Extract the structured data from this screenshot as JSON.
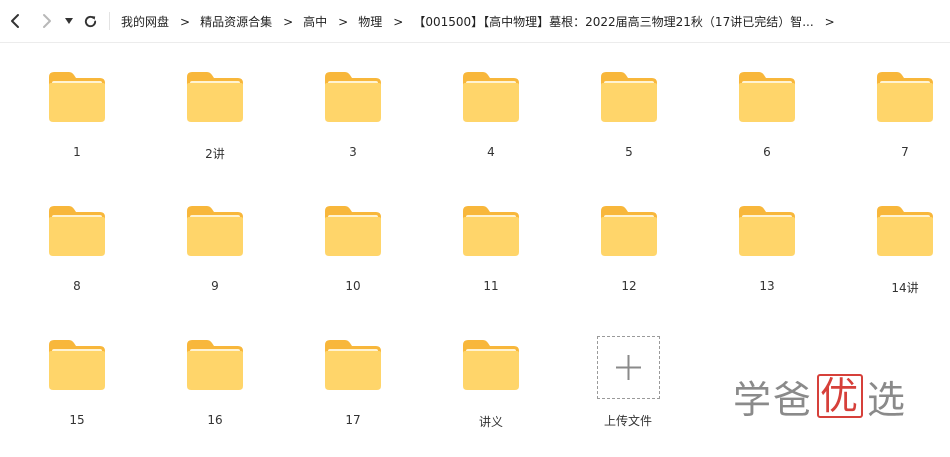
{
  "nav": {
    "back_icon": "chevron-left-icon",
    "forward_icon": "chevron-right-icon",
    "history_icon": "caret-down-icon",
    "refresh_icon": "refresh-icon"
  },
  "breadcrumb": [
    "我的网盘",
    "精品资源合集",
    "高中",
    "物理",
    "【001500】【高中物理】墓根：2022届高三物理21秋（17讲已完结）智..."
  ],
  "breadcrumb_sep": ">",
  "folders": [
    "1",
    "2讲",
    "3",
    "4",
    "5",
    "6",
    "7",
    "8",
    "9",
    "10",
    "11",
    "12",
    "13",
    "14讲",
    "15",
    "16",
    "17",
    "讲义"
  ],
  "upload": {
    "label": "上传文件",
    "icon": "plus-icon"
  },
  "watermark": {
    "part1": "学爸",
    "seal": "优",
    "part2": "选"
  },
  "colors": {
    "folder_front": "#FFD56A",
    "folder_back": "#F8B73B",
    "watermark_red": "#D6403A"
  }
}
